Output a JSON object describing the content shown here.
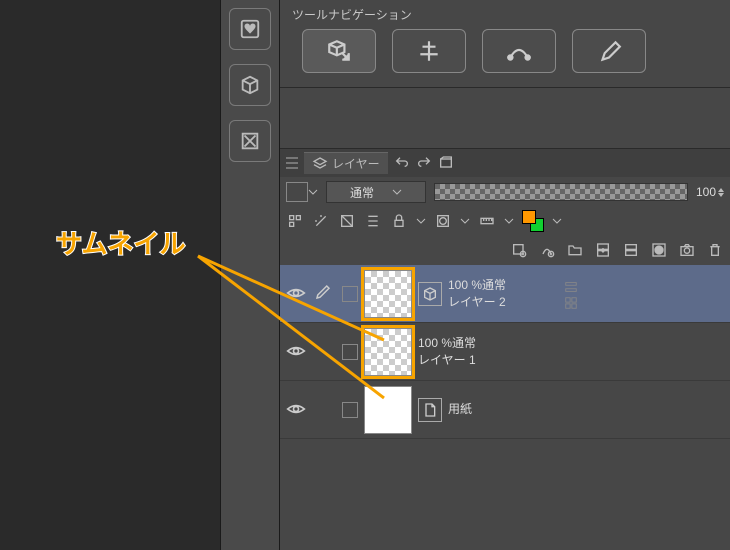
{
  "toolnav": {
    "title": "ツールナビゲーション"
  },
  "layer_panel": {
    "tab_label": "レイヤー",
    "blend_mode": "通常",
    "opacity": "100"
  },
  "layers": [
    {
      "info": "100 %通常",
      "name": "レイヤー 2"
    },
    {
      "info": "100 %通常",
      "name": "レイヤー 1"
    },
    {
      "info": "",
      "name": "用紙"
    }
  ],
  "annotation": {
    "text": "サムネイル"
  }
}
